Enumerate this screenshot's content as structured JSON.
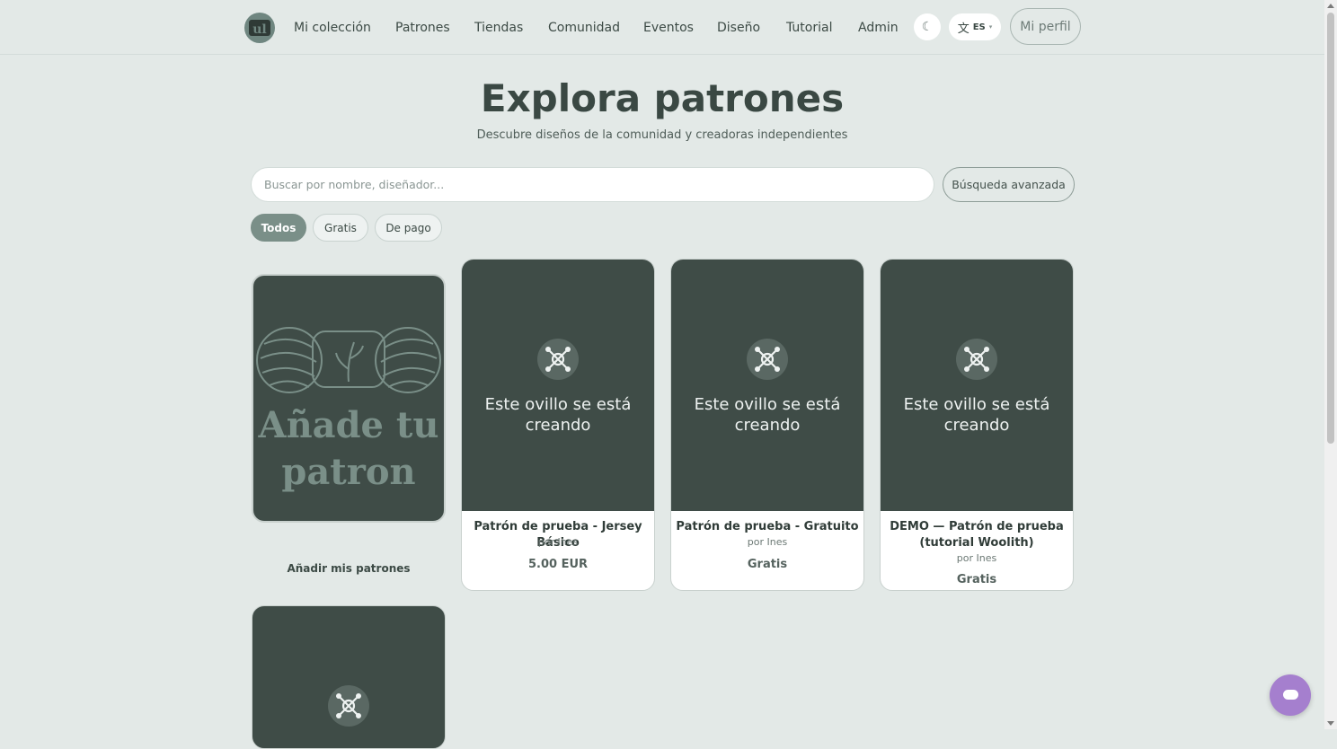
{
  "header": {
    "logo_text": "ul",
    "nav": [
      "Mi colección",
      "Patrones",
      "Tiendas",
      "Comunidad",
      "Eventos",
      "Diseño",
      "Tutorial",
      "Admin"
    ],
    "theme_icon": "☾",
    "language_icon": "文",
    "language_code": "ES",
    "language_caret": "▾",
    "profile_label": "Mi perfil"
  },
  "hero": {
    "title": "Explora patrones",
    "subtitle": "Descubre diseños de la comunidad y creadoras independientes"
  },
  "search": {
    "placeholder": "Buscar por nombre, diseñador...",
    "value": "",
    "advanced_label": "Búsqueda avanzada"
  },
  "filters": [
    {
      "label": "Todos",
      "active": true
    },
    {
      "label": "Gratis",
      "active": false
    },
    {
      "label": "De pago",
      "active": false
    }
  ],
  "add_card": {
    "art_text_line1": "Añade tu",
    "art_text_line2": "patron",
    "label": "Añadir mis patrones"
  },
  "patterns": [
    {
      "cover_text": "Este ovillo se está creando",
      "title": "Patrón de prueba - Jersey Básico",
      "author": "por Ines",
      "price": "5.00 EUR"
    },
    {
      "cover_text": "Este ovillo se está creando",
      "title": "Patrón de prueba - Gratuito",
      "author": "por Ines",
      "price": "Gratis"
    },
    {
      "cover_text": "Este ovillo se está creando",
      "title": "DEMO — Patrón de prueba (tutorial Woolith)",
      "author": "por Ines",
      "price": "Gratis"
    }
  ],
  "icons": {
    "logo": "yarn-logo-icon",
    "theme": "moon-icon",
    "language": "translate-icon",
    "cover": "needles-cross-icon",
    "chat": "chat-bubble-icon"
  },
  "colors": {
    "background": "#e3e9e7",
    "card_dark": "#3f4c47",
    "accent": "#7a8f88",
    "chat": "#a57fce"
  }
}
